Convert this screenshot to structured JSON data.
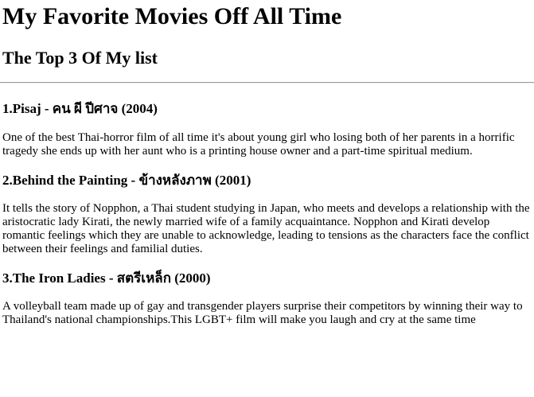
{
  "page": {
    "title": "My Favorite Movies Off All Time",
    "subtitle": "The Top 3 Of My list"
  },
  "movies": [
    {
      "heading": "1.Pisaj - คน ผี ปีศาจ (2004)",
      "description": "One of the best Thai-horror film of all time it's about young girl who losing both of her parents in a horrific tragedy she ends up with her aunt who is a printing house owner and a part-time spiritual medium."
    },
    {
      "heading": "2.Behind the Painting - ข้างหลังภาพ (2001)",
      "description": "It tells the story of Nopphon, a Thai student studying in Japan, who meets and develops a relationship with the aristocratic lady Kirati, the newly married wife of a family acquaintance. Nopphon and Kirati develop romantic feelings which they are unable to acknowledge, leading to tensions as the characters face the conflict between their feelings and familial duties."
    },
    {
      "heading": "3.The Iron Ladies - สตรีเหล็ก (2000)",
      "description": "A volleyball team made up of gay and transgender players surprise their competitors by winning their way to Thailand's national championships.This LGBT+ film will make you laugh and cry at the same time"
    }
  ]
}
